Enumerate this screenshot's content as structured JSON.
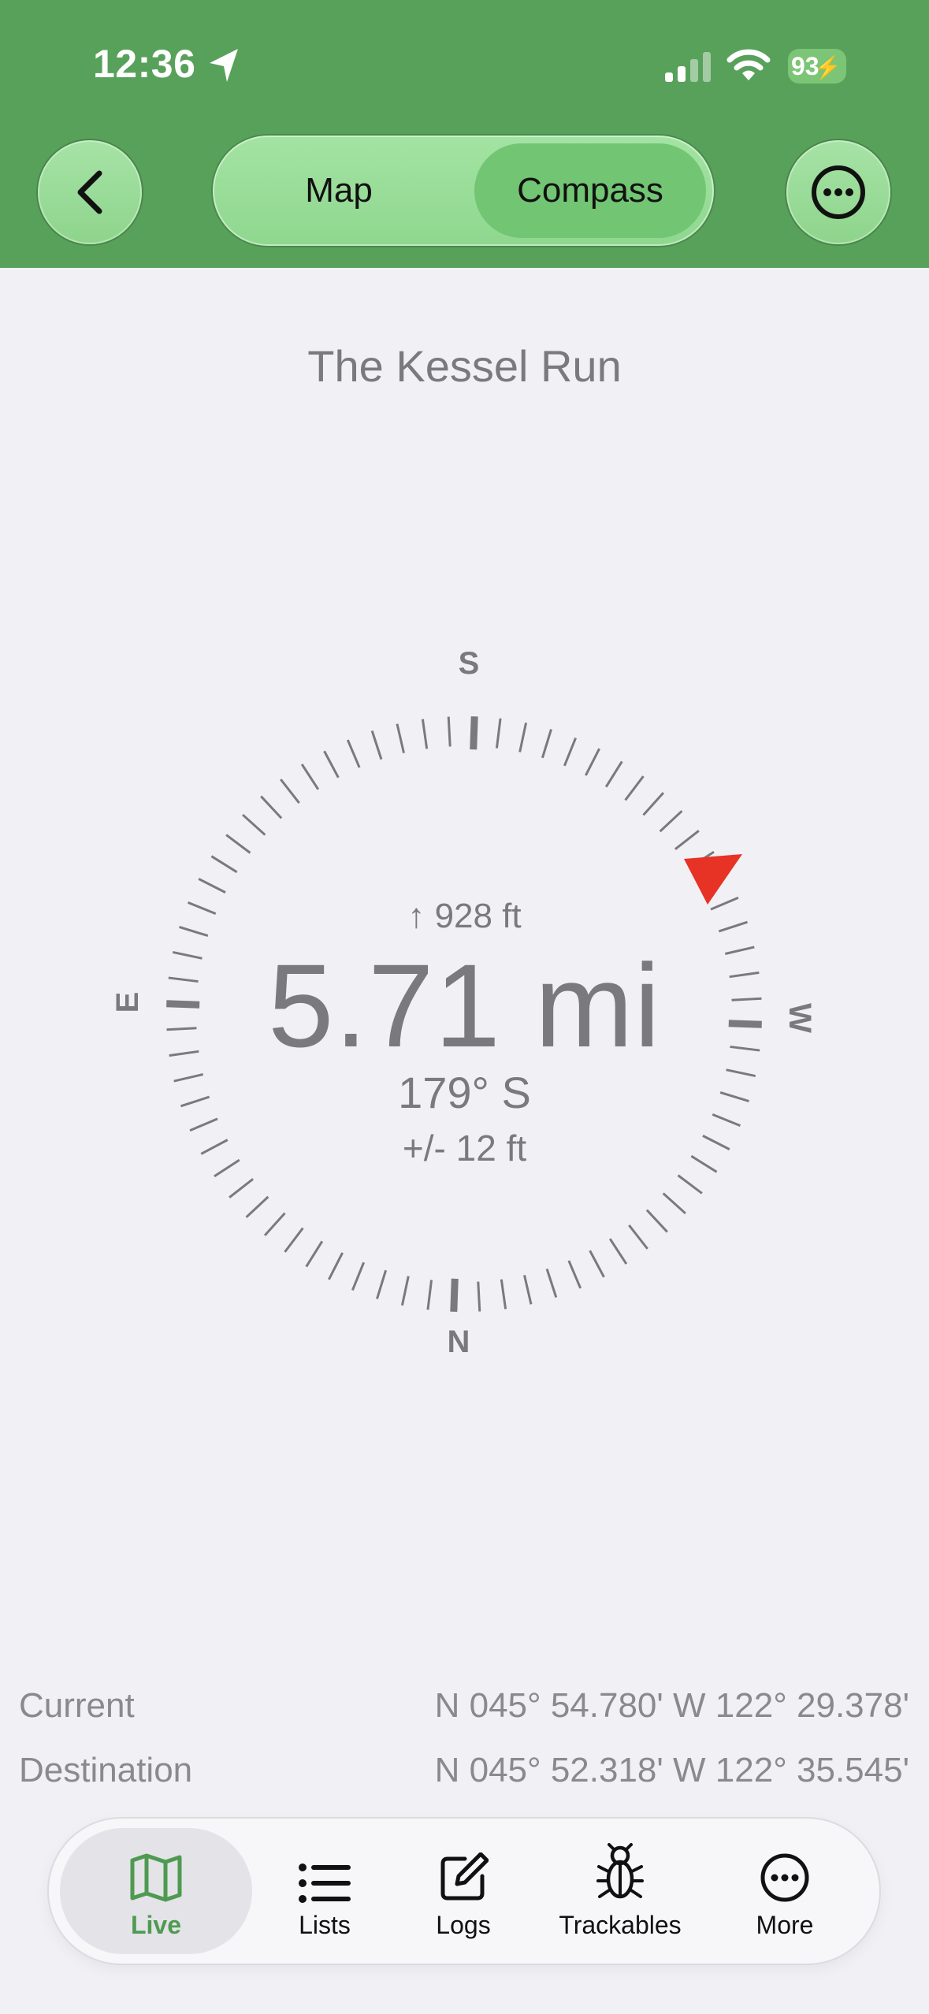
{
  "status_bar": {
    "time": "12:36",
    "battery": "93",
    "icons": [
      "location-arrow-icon",
      "cellular-signal-icon",
      "wifi-icon",
      "battery-charging-icon"
    ]
  },
  "header": {
    "background_color": "#58A15A",
    "segments": [
      {
        "label": "Map",
        "selected": false
      },
      {
        "label": "Compass",
        "selected": true
      }
    ]
  },
  "compass": {
    "title": "The Kessel Run",
    "elevation": "928 ft",
    "distance": "5.71 mi",
    "bearing": "179° S",
    "accuracy": "+/- 12 ft",
    "cardinals": {
      "top": "S",
      "bottom": "N",
      "left": "E",
      "right": "W"
    },
    "pointer_color": "#E63325"
  },
  "coordinates": {
    "current_label": "Current",
    "current_value": "N 045° 54.780' W 122° 29.378'",
    "destination_label": "Destination",
    "destination_value": "N 045° 52.318' W 122° 35.545'"
  },
  "tabbar": {
    "accent_color": "#4F9A51",
    "tabs": [
      {
        "label": "Live",
        "icon": "map-icon",
        "selected": true
      },
      {
        "label": "Lists",
        "icon": "list-icon",
        "selected": false
      },
      {
        "label": "Logs",
        "icon": "compose-icon",
        "selected": false
      },
      {
        "label": "Trackables",
        "icon": "bug-icon",
        "selected": false
      },
      {
        "label": "More",
        "icon": "ellipsis-circle-icon",
        "selected": false
      }
    ]
  }
}
